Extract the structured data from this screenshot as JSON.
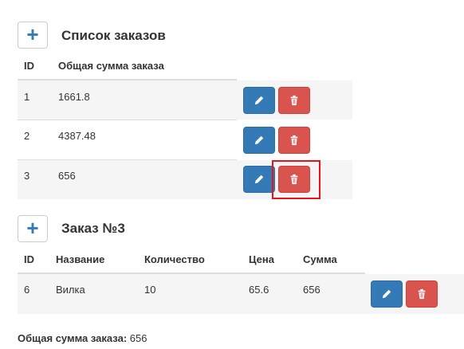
{
  "orders": {
    "title": "Список заказов",
    "headers": {
      "id": "ID",
      "total": "Общая сумма заказа"
    },
    "rows": [
      {
        "id": "1",
        "total": "1661.8"
      },
      {
        "id": "2",
        "total": "4387.48"
      },
      {
        "id": "3",
        "total": "656"
      }
    ]
  },
  "order": {
    "title": "Заказ №3",
    "headers": {
      "id": "ID",
      "name": "Название",
      "qty": "Количество",
      "price": "Цена",
      "sum": "Сумма"
    },
    "rows": [
      {
        "id": "6",
        "name": "Вилка",
        "qty": "10",
        "price": "65.6",
        "sum": "656"
      }
    ],
    "total_label": "Общая сумма заказа:",
    "total_value": "656"
  },
  "icons": {
    "add": "plus-icon",
    "edit": "pencil-icon",
    "delete": "trash-icon"
  },
  "colors": {
    "primary": "#337ab7",
    "danger": "#d9534f",
    "highlight": "#e8141a"
  }
}
